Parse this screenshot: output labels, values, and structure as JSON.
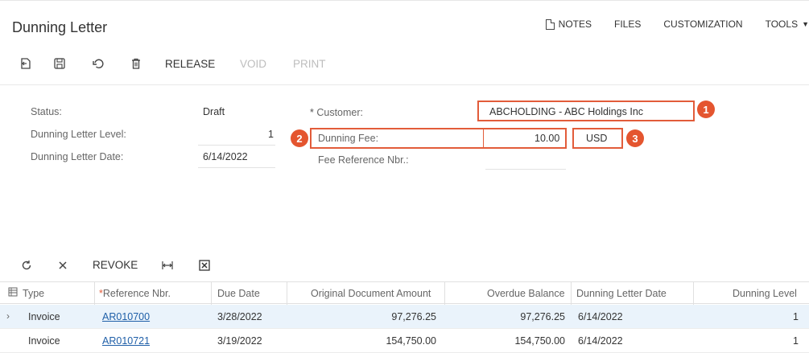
{
  "header": {
    "title": "Dunning Letter",
    "actions": [
      {
        "label": "NOTES",
        "icon": "note-icon"
      },
      {
        "label": "FILES"
      },
      {
        "label": "CUSTOMIZATION"
      },
      {
        "label": "TOOLS",
        "icon": "chevron-down-icon"
      }
    ]
  },
  "toolbar": {
    "release": "RELEASE",
    "void": "VOID",
    "print": "PRINT"
  },
  "form": {
    "status_label": "Status:",
    "status_value": "Draft",
    "level_label": "Dunning Letter Level:",
    "level_value": "1",
    "date_label": "Dunning Letter Date:",
    "date_value": "6/14/2022",
    "customer_required": "*",
    "customer_label": "Customer:",
    "customer_value": "ABCHOLDING - ABC Holdings Inc",
    "fee_label": "Dunning Fee:",
    "fee_value": "10.00",
    "currency_value": "USD",
    "fee_ref_label": "Fee Reference Nbr.:",
    "fee_ref_value": ""
  },
  "callouts": [
    "1",
    "2",
    "3"
  ],
  "grid_toolbar": {
    "revoke": "REVOKE"
  },
  "grid": {
    "columns": {
      "type": "Type",
      "ref_required": "*",
      "ref": "Reference Nbr.",
      "due": "Due Date",
      "orig": "Original Document Amount",
      "overdue": "Overdue Balance",
      "letter_date": "Dunning Letter Date",
      "level": "Dunning Level"
    },
    "rows": [
      {
        "type": "Invoice",
        "ref": "AR010700",
        "due": "3/28/2022",
        "orig": "97,276.25",
        "overdue": "97,276.25",
        "letter_date": "6/14/2022",
        "level": "1"
      },
      {
        "type": "Invoice",
        "ref": "AR010721",
        "due": "3/19/2022",
        "orig": "154,750.00",
        "overdue": "154,750.00",
        "letter_date": "6/14/2022",
        "level": "1"
      }
    ]
  },
  "colors": {
    "highlight": "#e25c3a",
    "badge": "#e4552f",
    "link": "#1f5fa8",
    "selected_row": "#eaf3fb"
  }
}
